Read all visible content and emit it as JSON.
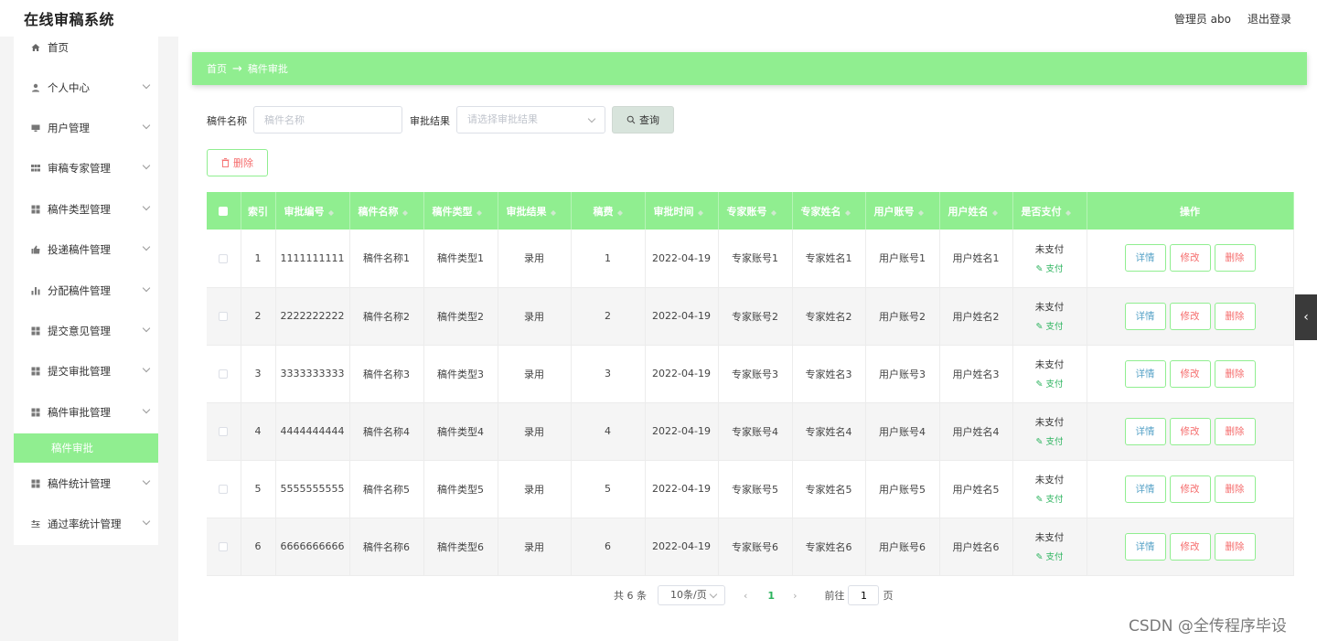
{
  "app": {
    "title": "在线审稿系统"
  },
  "header": {
    "user": "管理员 abo",
    "logout": "退出登录"
  },
  "sidebar": {
    "items": [
      {
        "label": "首页",
        "icon": "home-icon"
      },
      {
        "label": "个人中心",
        "icon": "user-icon"
      },
      {
        "label": "用户管理",
        "icon": "monitor-icon"
      },
      {
        "label": "审稿专家管理",
        "icon": "grid-icon"
      },
      {
        "label": "稿件类型管理",
        "icon": "grid-icon"
      },
      {
        "label": "投递稿件管理",
        "icon": "thumb-icon"
      },
      {
        "label": "分配稿件管理",
        "icon": "bar-chart-icon"
      },
      {
        "label": "提交意见管理",
        "icon": "grid-icon"
      },
      {
        "label": "提交审批管理",
        "icon": "grid-icon"
      },
      {
        "label": "稿件审批管理",
        "icon": "grid-icon"
      },
      {
        "label": "稿件统计管理",
        "icon": "grid-icon"
      },
      {
        "label": "通过率统计管理",
        "icon": "sliders-icon"
      }
    ],
    "active_sub": "稿件审批"
  },
  "breadcrumb": {
    "home": "首页",
    "arrow": "→",
    "current": "稿件审批"
  },
  "search": {
    "name_label": "稿件名称",
    "name_placeholder": "稿件名称",
    "result_label": "审批结果",
    "result_placeholder": "请选择审批结果",
    "query_button": "查询"
  },
  "toolbar": {
    "delete_label": "删除"
  },
  "table": {
    "headers": [
      "索引",
      "审批编号",
      "稿件名称",
      "稿件类型",
      "审批结果",
      "稿费",
      "审批时间",
      "专家账号",
      "专家姓名",
      "用户账号",
      "用户姓名",
      "是否支付",
      "操作"
    ],
    "rows": [
      {
        "index": "1",
        "code": "1111111111",
        "name": "稿件名称1",
        "type": "稿件类型1",
        "result": "录用",
        "fee": "1",
        "time": "2022-04-19",
        "expert_account": "专家账号1",
        "expert_name": "专家姓名1",
        "user_account": "用户账号1",
        "user_name": "用户姓名1",
        "paid": "未支付",
        "pay_action": "支付"
      },
      {
        "index": "2",
        "code": "2222222222",
        "name": "稿件名称2",
        "type": "稿件类型2",
        "result": "录用",
        "fee": "2",
        "time": "2022-04-19",
        "expert_account": "专家账号2",
        "expert_name": "专家姓名2",
        "user_account": "用户账号2",
        "user_name": "用户姓名2",
        "paid": "未支付",
        "pay_action": "支付"
      },
      {
        "index": "3",
        "code": "3333333333",
        "name": "稿件名称3",
        "type": "稿件类型3",
        "result": "录用",
        "fee": "3",
        "time": "2022-04-19",
        "expert_account": "专家账号3",
        "expert_name": "专家姓名3",
        "user_account": "用户账号3",
        "user_name": "用户姓名3",
        "paid": "未支付",
        "pay_action": "支付"
      },
      {
        "index": "4",
        "code": "4444444444",
        "name": "稿件名称4",
        "type": "稿件类型4",
        "result": "录用",
        "fee": "4",
        "time": "2022-04-19",
        "expert_account": "专家账号4",
        "expert_name": "专家姓名4",
        "user_account": "用户账号4",
        "user_name": "用户姓名4",
        "paid": "未支付",
        "pay_action": "支付"
      },
      {
        "index": "5",
        "code": "5555555555",
        "name": "稿件名称5",
        "type": "稿件类型5",
        "result": "录用",
        "fee": "5",
        "time": "2022-04-19",
        "expert_account": "专家账号5",
        "expert_name": "专家姓名5",
        "user_account": "用户账号5",
        "user_name": "用户姓名5",
        "paid": "未支付",
        "pay_action": "支付"
      },
      {
        "index": "6",
        "code": "6666666666",
        "name": "稿件名称6",
        "type": "稿件类型6",
        "result": "录用",
        "fee": "6",
        "time": "2022-04-19",
        "expert_account": "专家账号6",
        "expert_name": "专家姓名6",
        "user_account": "用户账号6",
        "user_name": "用户姓名6",
        "paid": "未支付",
        "pay_action": "支付"
      }
    ],
    "actions": {
      "detail": "详情",
      "edit": "修改",
      "delete": "删除"
    }
  },
  "pagination": {
    "total": "共 6 条",
    "page_size": "10条/页",
    "prev": "‹",
    "current_page": "1",
    "next": "›",
    "goto_label": "前往",
    "goto_value": "1",
    "page_suffix": "页"
  },
  "side_tab": {
    "icon": "chevron-left-icon",
    "glyph": "‹"
  },
  "watermark": "CSDN @全传程序毕设",
  "colors": {
    "accent": "#90ee90",
    "danger": "#f56c6c",
    "link": "#2bb35d"
  }
}
